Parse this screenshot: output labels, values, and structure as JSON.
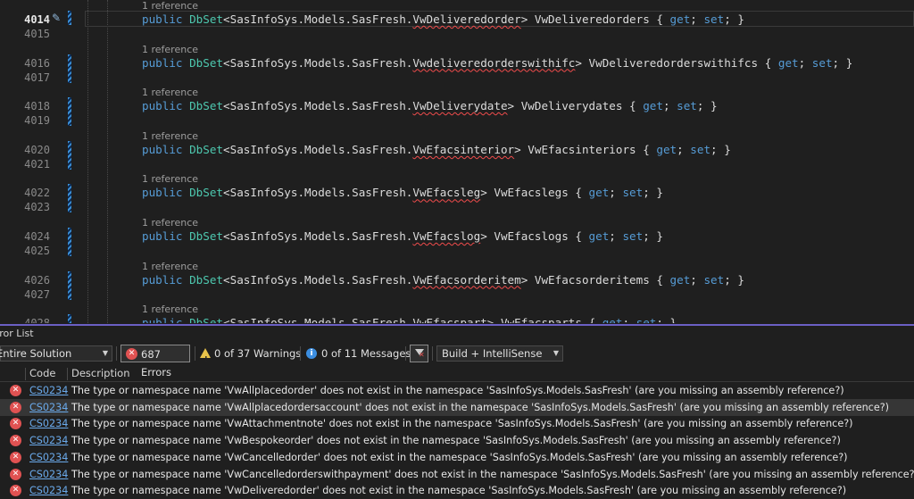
{
  "editor": {
    "blocks": [
      {
        "ln": "4014",
        "blank": "4015",
        "ref": "1 reference",
        "type": "VwDeliveredorder",
        "prop": "VwDeliveredorders",
        "current": true
      },
      {
        "ln": "4016",
        "blank": "4017",
        "ref": "1 reference",
        "type": "Vwdeliveredorderswithifc",
        "prop": "VwDeliveredorderswithifcs",
        "current": false
      },
      {
        "ln": "4018",
        "blank": "4019",
        "ref": "1 reference",
        "type": "VwDeliverydate",
        "prop": "VwDeliverydates",
        "current": false
      },
      {
        "ln": "4020",
        "blank": "4021",
        "ref": "1 reference",
        "type": "VwEfacsinterior",
        "prop": "VwEfacsinteriors",
        "current": false
      },
      {
        "ln": "4022",
        "blank": "4023",
        "ref": "1 reference",
        "type": "VwEfacsleg",
        "prop": "VwEfacslegs",
        "current": false
      },
      {
        "ln": "4024",
        "blank": "4025",
        "ref": "1 reference",
        "type": "VwEfacslog",
        "prop": "VwEfacslogs",
        "current": false
      },
      {
        "ln": "4026",
        "blank": "4027",
        "ref": "1 reference",
        "type": "VwEfacsorderitem",
        "prop": "VwEfacsorderitems",
        "current": false
      },
      {
        "ln": "4028",
        "blank": "",
        "ref": "1 reference",
        "type": "VwEfacspart",
        "prop": "VwEfacsparts",
        "current": false
      }
    ],
    "code_parts": {
      "public": "public",
      "dbset": "DbSet",
      "lt": "<",
      "ns1": "SasInfoSys",
      "ns2": "Models",
      "ns3": "SasFresh",
      "dot": ".",
      "gt": "> ",
      "open": " { ",
      "get": "get",
      "semi": "; ",
      "set": "set",
      "close": "; }"
    },
    "colors": {
      "keyword": "#569cd6",
      "type": "#4ec9b0",
      "text": "#dcdcdc",
      "error_squiggle": "#f14c4c"
    }
  },
  "panel": {
    "title": "Error List",
    "scope": "Entire Solution",
    "errors_label": "687 Errors",
    "warnings_label": "0 of 37 Warnings",
    "messages_label": "0 of 11 Messages",
    "build_filter": "Build + IntelliSense",
    "columns": {
      "code": "Code",
      "description": "Description"
    },
    "rows": [
      {
        "code": "CS0234",
        "desc": "The type or namespace name 'VwAllplacedorder' does not exist in the namespace 'SasInfoSys.Models.SasFresh' (are you missing an assembly reference?)",
        "selected": false
      },
      {
        "code": "CS0234",
        "desc": "The type or namespace name 'VwAllplacedordersaccount' does not exist in the namespace 'SasInfoSys.Models.SasFresh' (are you missing an assembly reference?)",
        "selected": true
      },
      {
        "code": "CS0234",
        "desc": "The type or namespace name 'VwAttachmentnote' does not exist in the namespace 'SasInfoSys.Models.SasFresh' (are you missing an assembly reference?)",
        "selected": false
      },
      {
        "code": "CS0234",
        "desc": "The type or namespace name 'VwBespokeorder' does not exist in the namespace 'SasInfoSys.Models.SasFresh' (are you missing an assembly reference?)",
        "selected": false
      },
      {
        "code": "CS0234",
        "desc": "The type or namespace name 'VwCancelledorder' does not exist in the namespace 'SasInfoSys.Models.SasFresh' (are you missing an assembly reference?)",
        "selected": false
      },
      {
        "code": "CS0234",
        "desc": "The type or namespace name 'VwCancelledorderswithpayment' does not exist in the namespace 'SasInfoSys.Models.SasFresh' (are you missing an assembly reference?)",
        "selected": false
      },
      {
        "code": "CS0234",
        "desc": "The type or namespace name 'VwDeliveredorder' does not exist in the namespace 'SasInfoSys.Models.SasFresh' (are you missing an assembly reference?)",
        "selected": false
      }
    ]
  }
}
